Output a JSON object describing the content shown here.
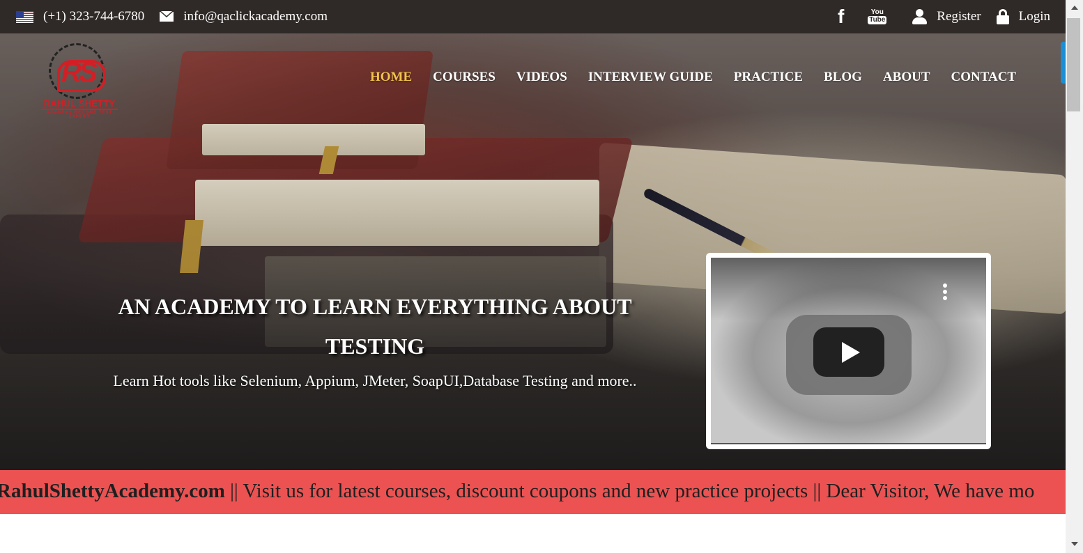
{
  "topbar": {
    "phone": "(+1) 323-744-6780",
    "email": "info@qaclickacademy.com",
    "register": "Register",
    "login": "Login",
    "youtube_top": "You",
    "youtube_bottom": "Tube"
  },
  "logo": {
    "monogram": "RS",
    "name": "RAHUL SHETTY",
    "subtitle": "ACADEMY",
    "tagline": "BECOME TEST EXPERT"
  },
  "nav": {
    "items": [
      "HOME",
      "COURSES",
      "VIDEOS",
      "INTERVIEW GUIDE",
      "PRACTICE",
      "BLOG",
      "ABOUT",
      "CONTACT"
    ],
    "active": "HOME"
  },
  "hero": {
    "title_line1": "AN ACADEMY TO LEARN EVERYTHING ABOUT",
    "title_line2": "TESTING",
    "subtitle": "Learn Hot tools like Selenium, Appium, JMeter, SoapUI,Database Testing and more.."
  },
  "ticker": {
    "site": "RahulShettyAcademy.com",
    "text": " || Visit us for latest courses, discount coupons and new practice projects || Dear Visitor, We have mo"
  },
  "colors": {
    "topbar_bg": "#2f2a27",
    "nav_active": "#f3c44a",
    "ticker_bg": "#ec5252",
    "brand_red": "#d21f26"
  },
  "icons": [
    "us-flag-icon",
    "envelope-icon",
    "facebook-icon",
    "youtube-icon",
    "user-icon",
    "lock-icon",
    "play-icon",
    "more-vert-icon"
  ]
}
